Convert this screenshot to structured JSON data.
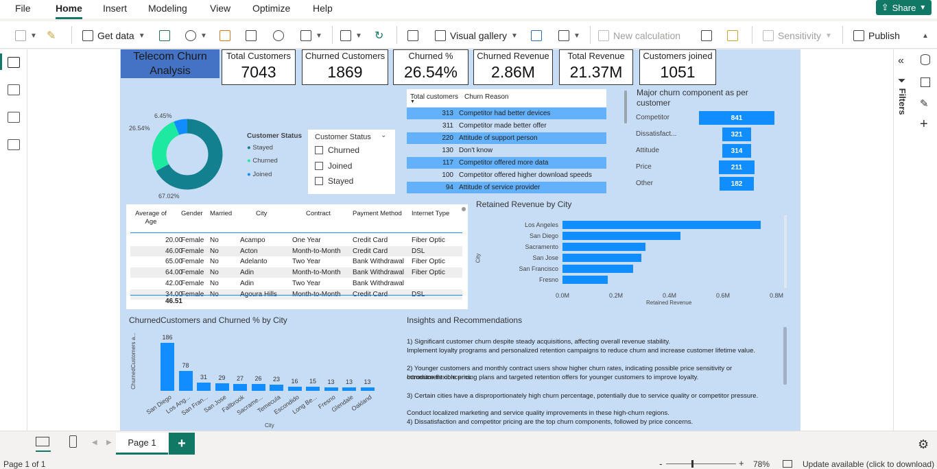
{
  "menu": {
    "file": "File",
    "home": "Home",
    "insert": "Insert",
    "modeling": "Modeling",
    "view": "View",
    "optimize": "Optimize",
    "help": "Help",
    "share": "Share"
  },
  "ribbon": {
    "get_data": "Get data",
    "visual_gallery": "Visual gallery",
    "new_calculation": "New calculation",
    "sensitivity": "Sensitivity",
    "publish": "Publish"
  },
  "report": {
    "title": "Telecom Churn Analysis",
    "cards": [
      {
        "label": "Total Customers",
        "value": "7043"
      },
      {
        "label": "Churned Customers",
        "value": "1869"
      },
      {
        "label": "Churned %",
        "value": "26.54%"
      },
      {
        "label": "Churned Revenue",
        "value": "2.86M"
      },
      {
        "label": "Total Revenue",
        "value": "21.37M"
      },
      {
        "label": "Customers joined",
        "value": "1051"
      }
    ],
    "donut": {
      "labels": {
        "joined": "6.45%",
        "churned": "26.54%",
        "stayed": "67.02%"
      },
      "legend_title": "Customer Status",
      "legend": [
        "Stayed",
        "Churned",
        "Joined"
      ],
      "colors": {
        "stayed": "#12808f",
        "churned": "#1de9a0",
        "joined": "#118dff"
      }
    },
    "slicer": {
      "title": "Customer Status",
      "options": [
        "Churned",
        "Joined",
        "Stayed"
      ]
    },
    "reasons": {
      "col1": "Total customers",
      "col2": "Churn Reason",
      "rows": [
        {
          "n": "313",
          "r": "Competitor had better devices"
        },
        {
          "n": "311",
          "r": "Competitor made better offer"
        },
        {
          "n": "220",
          "r": "Attitude of support person"
        },
        {
          "n": "130",
          "r": "Don't know"
        },
        {
          "n": "117",
          "r": "Competitor offered more data"
        },
        {
          "n": "100",
          "r": "Competitor offered higher download speeds"
        },
        {
          "n": "94",
          "r": "Attitude of service provider"
        }
      ]
    },
    "funnel": {
      "title": "Major churn component as per customer",
      "items": [
        {
          "label": "Competitor",
          "value": "841"
        },
        {
          "label": "Dissatisfact...",
          "value": "321"
        },
        {
          "label": "Attitude",
          "value": "314"
        },
        {
          "label": "Price",
          "value": "211"
        },
        {
          "label": "Other",
          "value": "182"
        }
      ]
    },
    "table": {
      "headers": [
        "Average of Age",
        "Gender",
        "Married",
        "City",
        "Contract",
        "Payment Method",
        "Internet Type"
      ],
      "rows": [
        [
          "20.00",
          "Female",
          "No",
          "Acampo",
          "One Year",
          "Credit Card",
          "Fiber Optic"
        ],
        [
          "46.00",
          "Female",
          "No",
          "Acton",
          "Month-to-Month",
          "Credit Card",
          "DSL"
        ],
        [
          "65.00",
          "Female",
          "No",
          "Adelanto",
          "Two Year",
          "Bank Withdrawal",
          "Fiber Optic"
        ],
        [
          "64.00",
          "Female",
          "No",
          "Adin",
          "Month-to-Month",
          "Bank Withdrawal",
          "Fiber Optic"
        ],
        [
          "42.00",
          "Female",
          "No",
          "Adin",
          "Two Year",
          "Bank Withdrawal",
          ""
        ],
        [
          "34.00",
          "Female",
          "No",
          "Agoura Hills",
          "Month-to-Month",
          "Credit Card",
          "DSL"
        ]
      ],
      "total": "46.51"
    },
    "insights": {
      "title": "Insights and Recommendations",
      "lines": [
        "1)  Significant customer churn despite steady acquisitions, affecting overall revenue stability.",
        "   Implement loyalty programs and personalized retention campaigns to reduce churn and increase customer lifetime value.",
        "2) Younger customers and monthly contract users show higher churn rates, indicating possible price sensitivity or commitment concerns.",
        " Introduce flexible pricing plans and targeted retention offers for younger customers to improve loyalty.",
        "3) Certain cities have a disproportionately high churn percentage, potentially due to service quality or competitor pressure.",
        " Conduct localized marketing and service quality improvements in these high-churn regions.",
        "4) Dissatisfaction and competitor pricing are the top churn components, followed by price concerns."
      ]
    }
  },
  "chart_data": [
    {
      "type": "bar",
      "orientation": "horizontal",
      "title": "Retained Revenue by City",
      "xlabel": "Retained Revenue",
      "ylabel": "City",
      "categories": [
        "Los Angeles",
        "San Diego",
        "Sacramento",
        "San Jose",
        "San Francisco",
        "Fresno"
      ],
      "values": [
        0.74,
        0.44,
        0.31,
        0.295,
        0.265,
        0.17
      ],
      "xlim": [
        0,
        0.8
      ],
      "xticks": [
        "0.0M",
        "0.2M",
        "0.4M",
        "0.6M",
        "0.8M"
      ]
    },
    {
      "type": "bar",
      "title": "ChurnedCustomers and Churned % by City",
      "xlabel": "City",
      "ylabel": "ChurnedCustomers a...",
      "categories": [
        "San Diego",
        "Los Ang...",
        "San Fran...",
        "San Jose",
        "Fallbrook",
        "Sacrame...",
        "Temecula",
        "Escondido",
        "Long Be...",
        "Fresno",
        "Glendale",
        "Oakland"
      ],
      "values": [
        186,
        78,
        31,
        29,
        27,
        26,
        23,
        16,
        15,
        13,
        13,
        13
      ]
    }
  ],
  "tabs": {
    "page1": "Page 1"
  },
  "status": {
    "page": "Page 1 of 1",
    "zoom": "78%",
    "update": "Update available (click to download)"
  },
  "filters": "Filters"
}
